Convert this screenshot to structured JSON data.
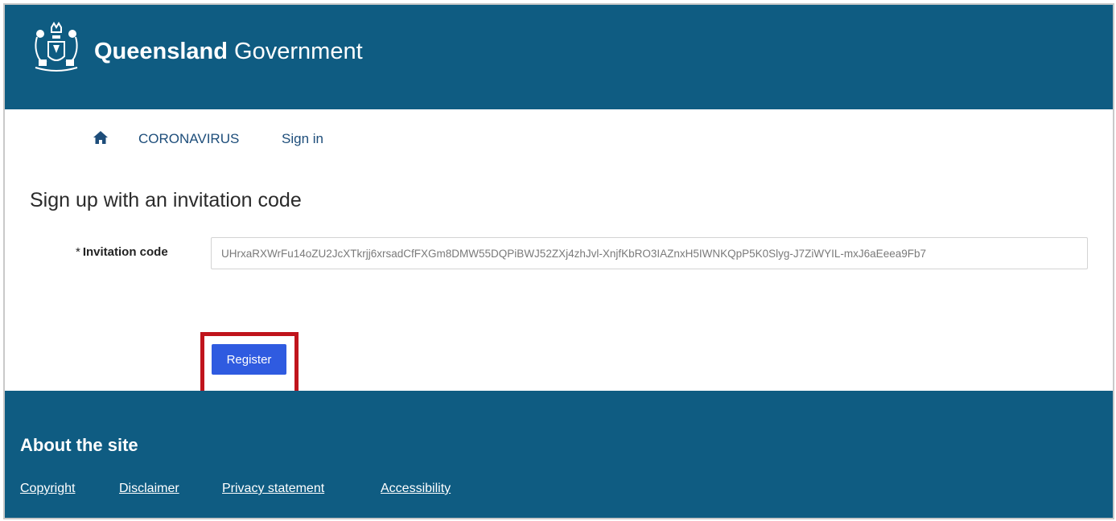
{
  "header": {
    "brand_bold": "Queensland",
    "brand_regular": " Government",
    "logo_icon": "coat-of-arms-icon"
  },
  "nav": {
    "home_icon": "home-icon",
    "links": [
      "CORONAVIRUS",
      "Sign in"
    ]
  },
  "main": {
    "title": "Sign up with an invitation code",
    "field": {
      "required_marker": "*",
      "label": "Invitation code",
      "value": "UHrxaRXWrFu14oZU2JcXTkrjj6xrsadCfFXGm8DMW55DQPiBWJ52ZXj4zhJvl-XnjfKbRO3IAZnxH5IWNKQpP5K0Slyg-J7ZiWYIL-mxJ6aEeea9Fb7"
    },
    "register_label": "Register"
  },
  "footer": {
    "title": "About the site",
    "links": [
      "Copyright",
      "Disclaimer",
      "Privacy statement",
      "Accessibility"
    ]
  },
  "colors": {
    "brand_blue": "#0f5c82",
    "button_blue": "#2f5be0",
    "highlight_red": "#c0141c",
    "nav_text": "#1d4d7a"
  }
}
